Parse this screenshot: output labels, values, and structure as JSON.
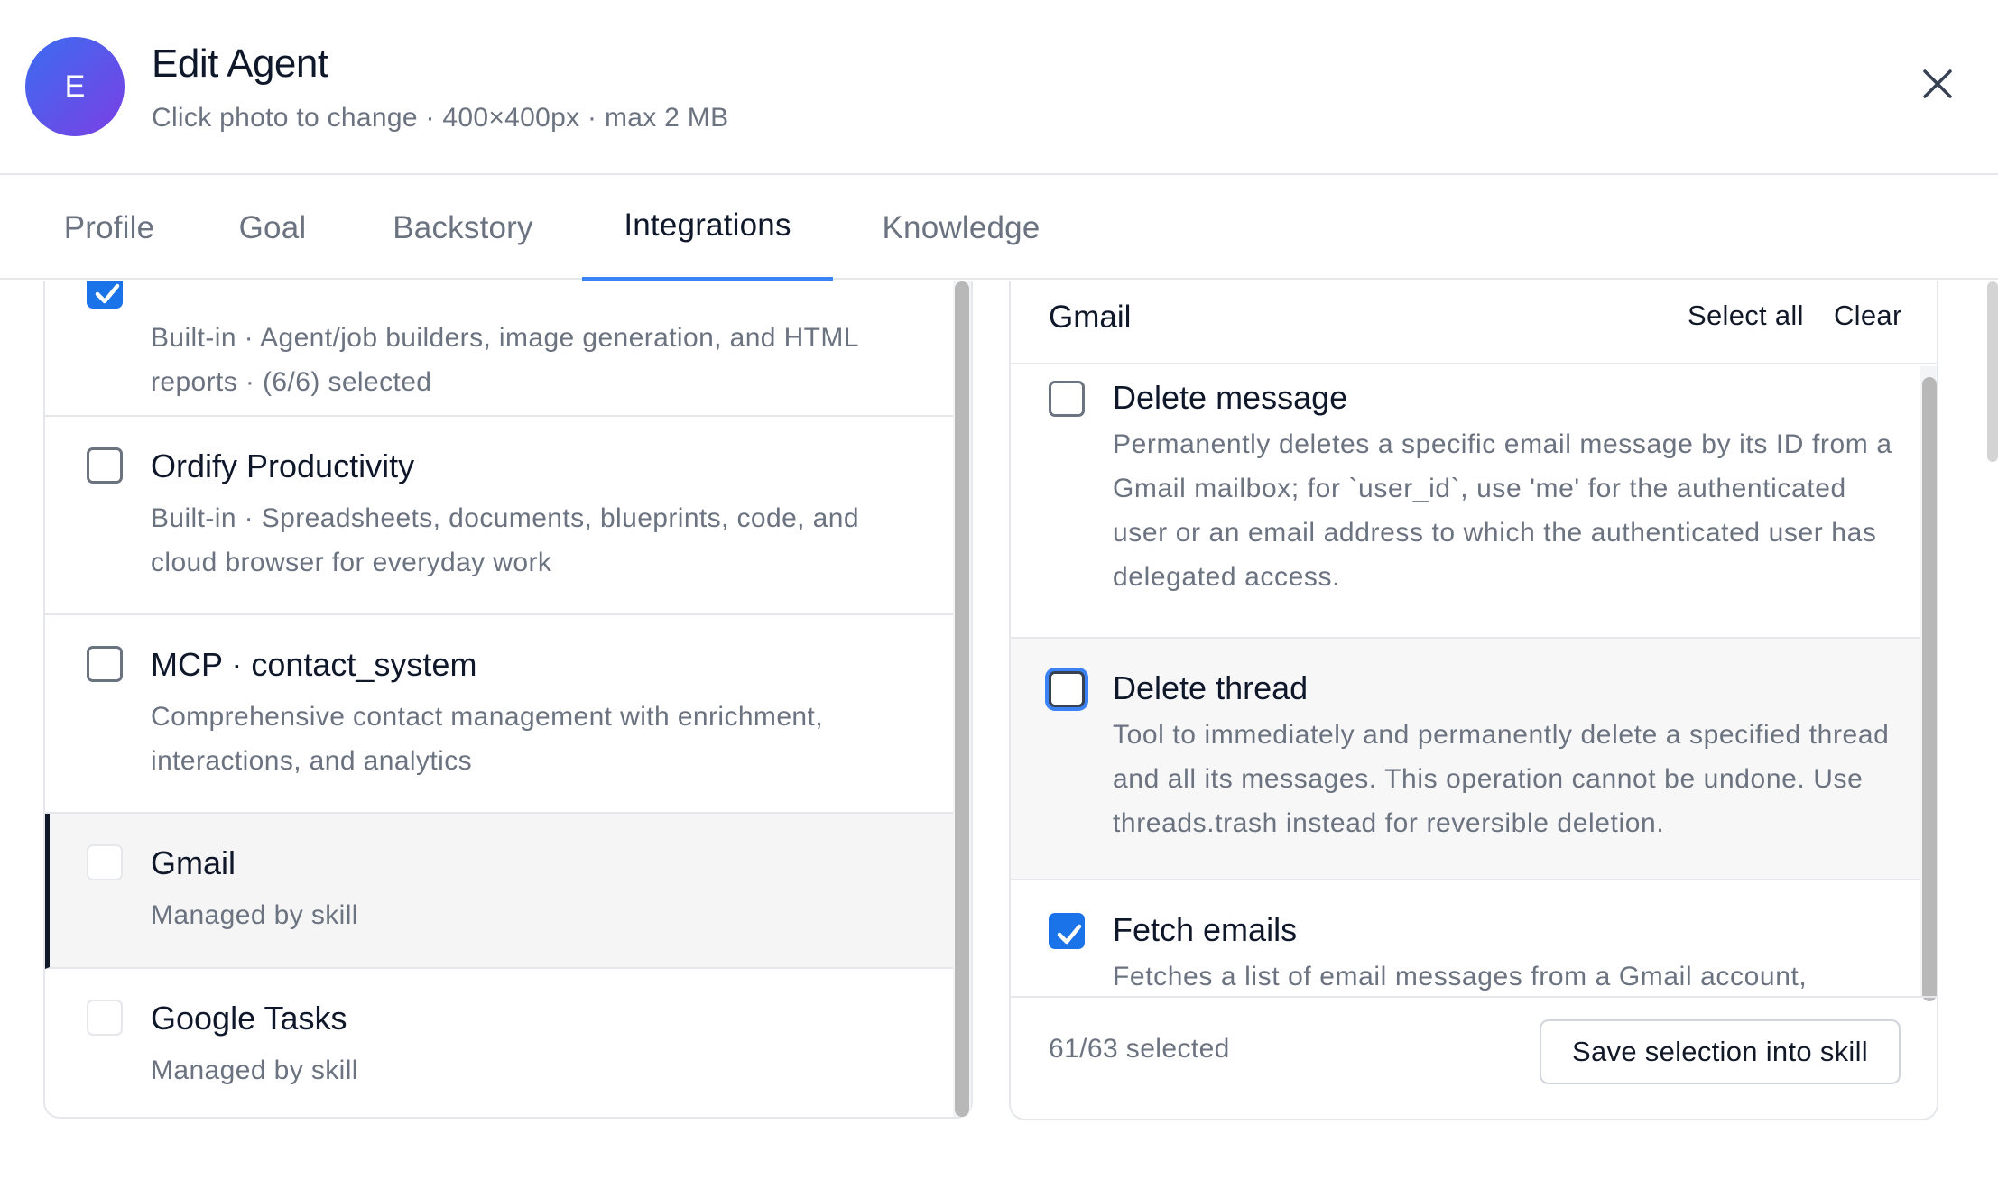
{
  "header": {
    "avatar_initial": "E",
    "title": "Edit Agent",
    "subtitle": "Click photo to change · 400×400px · max 2 MB"
  },
  "tabs": [
    {
      "label": "Profile",
      "active": false
    },
    {
      "label": "Goal",
      "active": false
    },
    {
      "label": "Backstory",
      "active": false
    },
    {
      "label": "Integrations",
      "active": true
    },
    {
      "label": "Knowledge",
      "active": false
    }
  ],
  "integrations": [
    {
      "name": "",
      "desc": "Built-in · Agent/job builders, image generation, and HTML reports · (6/6) selected",
      "checked": true,
      "disabled": false
    },
    {
      "name": "Ordify Productivity",
      "desc": "Built-in · Spreadsheets, documents, blueprints, code, and cloud browser for everyday work",
      "checked": false,
      "disabled": false
    },
    {
      "name": "MCP · contact_system",
      "desc": "Comprehensive contact management with enrichment, interactions, and analytics",
      "checked": false,
      "disabled": false
    },
    {
      "name": "Gmail",
      "desc": "Managed by skill",
      "checked": false,
      "disabled": true,
      "active": true
    },
    {
      "name": "Google Tasks",
      "desc": "Managed by skill",
      "checked": false,
      "disabled": true
    }
  ],
  "tools_panel": {
    "title": "Gmail",
    "select_all_label": "Select all",
    "clear_label": "Clear",
    "tools": [
      {
        "name": "Delete message",
        "desc": "Permanently deletes a specific email message by its ID from a Gmail mailbox; for `user_id`, use 'me' for the authenticated user or an email address to which the authenticated user has delegated access.",
        "checked": false
      },
      {
        "name": "Delete thread",
        "desc": "Tool to immediately and permanently delete a specified thread and all its messages. This operation cannot be undone. Use threads.trash instead for reversible deletion.",
        "checked": false
      },
      {
        "name": "Fetch emails",
        "desc": "Fetches a list of email messages from a Gmail account,",
        "checked": true
      }
    ],
    "selected_count": "61/63 selected",
    "save_label": "Save selection into skill"
  },
  "colors": {
    "accent": "#3b82f6",
    "checkbox_checked": "#1a73e8",
    "avatar_start": "#3b6df0",
    "avatar_end": "#7b3fe4"
  },
  "icons": {
    "close": "close-icon",
    "check": "check-icon"
  }
}
